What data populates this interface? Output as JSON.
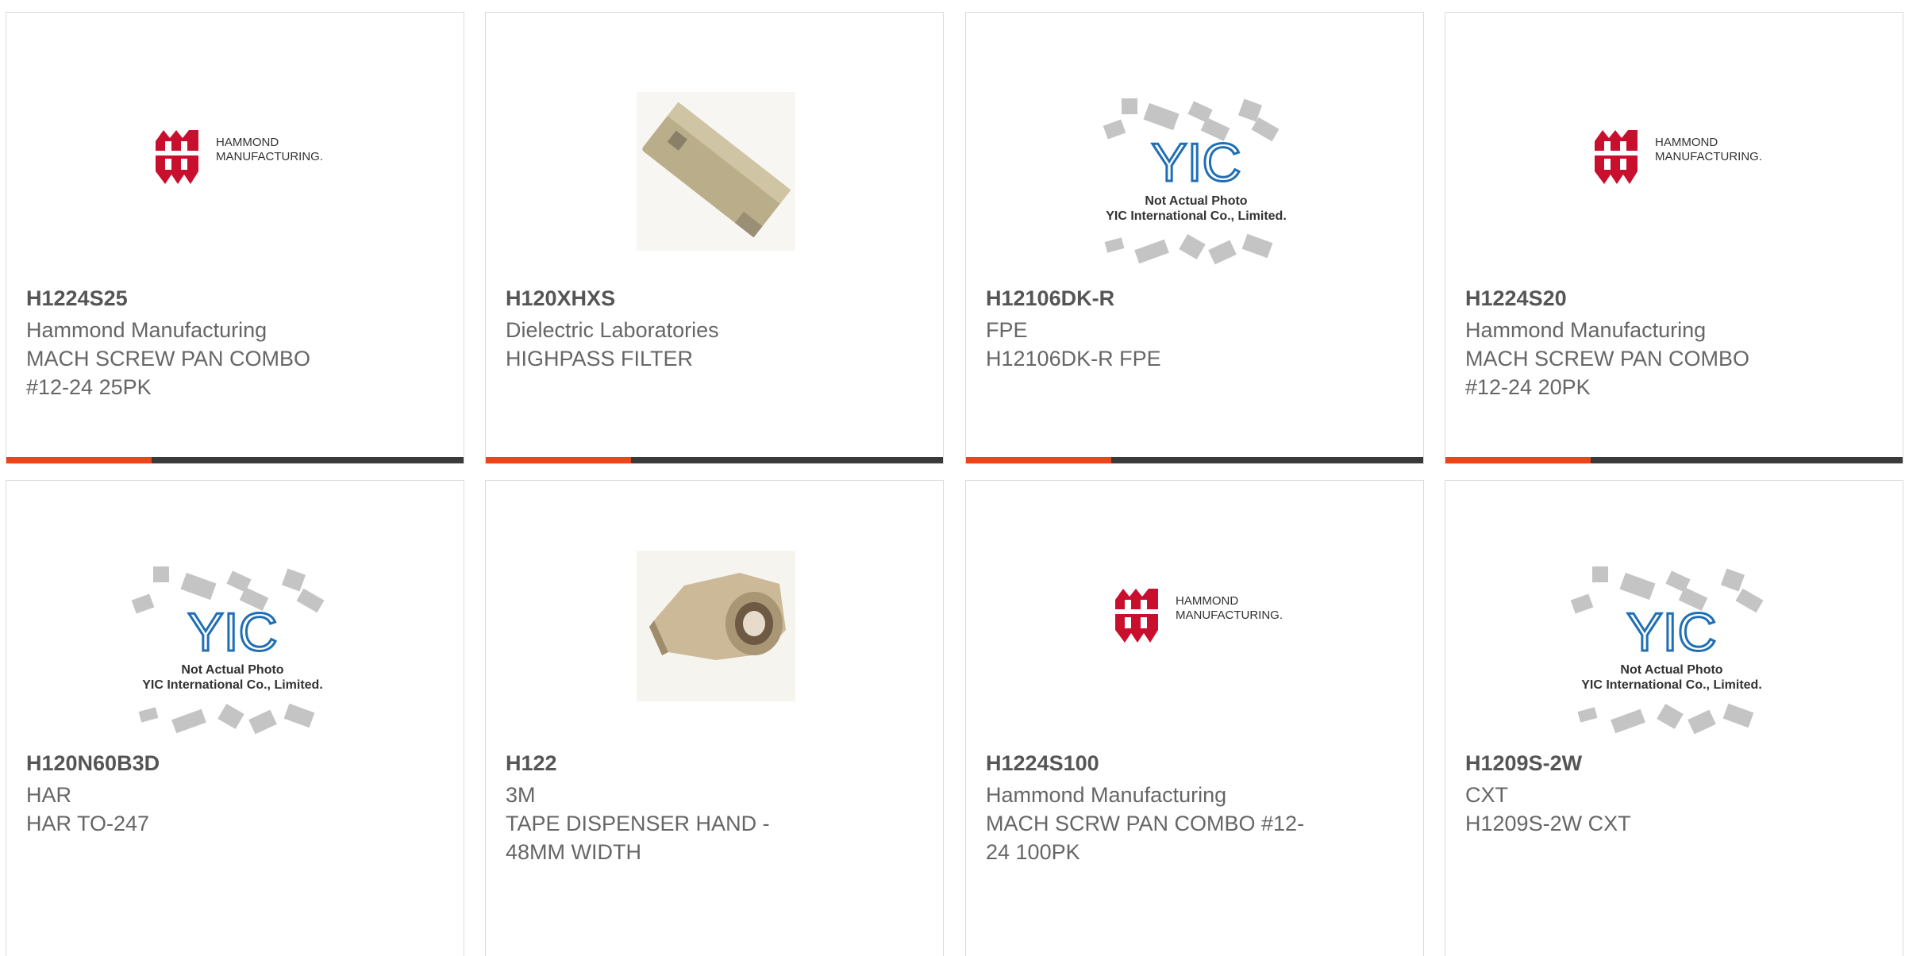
{
  "theme": {
    "accent": "#e8461c",
    "bar": "#3a3a3a",
    "brand_red": "#c8102e",
    "yic_blue": "#1f6fb5"
  },
  "products": [
    {
      "part": "H1224S25",
      "mfr": "Hammond Manufacturing",
      "desc": [
        "MACH SCREW PAN COMBO",
        "#12-24 25PK"
      ],
      "image": "hammond-logo"
    },
    {
      "part": "H120XHXS",
      "mfr": "Dielectric Laboratories",
      "desc": [
        "HIGHPASS FILTER"
      ],
      "image": "component-photo"
    },
    {
      "part": "H12106DK-R",
      "mfr": "FPE",
      "desc": [
        "H12106DK-R FPE"
      ],
      "image": "yic-placeholder"
    },
    {
      "part": "H1224S20",
      "mfr": "Hammond Manufacturing",
      "desc": [
        "MACH SCREW PAN COMBO",
        "#12-24 20PK"
      ],
      "image": "hammond-logo"
    },
    {
      "part": "H120N60B3D",
      "mfr": "HAR",
      "desc": [
        "HAR TO-247"
      ],
      "image": "yic-placeholder"
    },
    {
      "part": "H122",
      "mfr": "3M",
      "desc": [
        "TAPE DISPENSER HAND -",
        "48MM WIDTH"
      ],
      "image": "tape-dispenser-photo"
    },
    {
      "part": "H1224S100",
      "mfr": "Hammond Manufacturing",
      "desc": [
        "MACH SCRW PAN COMBO #12-",
        "24 100PK"
      ],
      "image": "hammond-logo"
    },
    {
      "part": "H1209S-2W",
      "mfr": "CXT",
      "desc": [
        "H1209S-2W CXT"
      ],
      "image": "yic-placeholder"
    }
  ],
  "logo_text": {
    "hammond_line1": "HAMMOND",
    "hammond_line2": "MANUFACTURING.",
    "yic_brand": "YIC",
    "yic_note1": "Not Actual Photo",
    "yic_note2": "YIC International Co., Limited."
  }
}
